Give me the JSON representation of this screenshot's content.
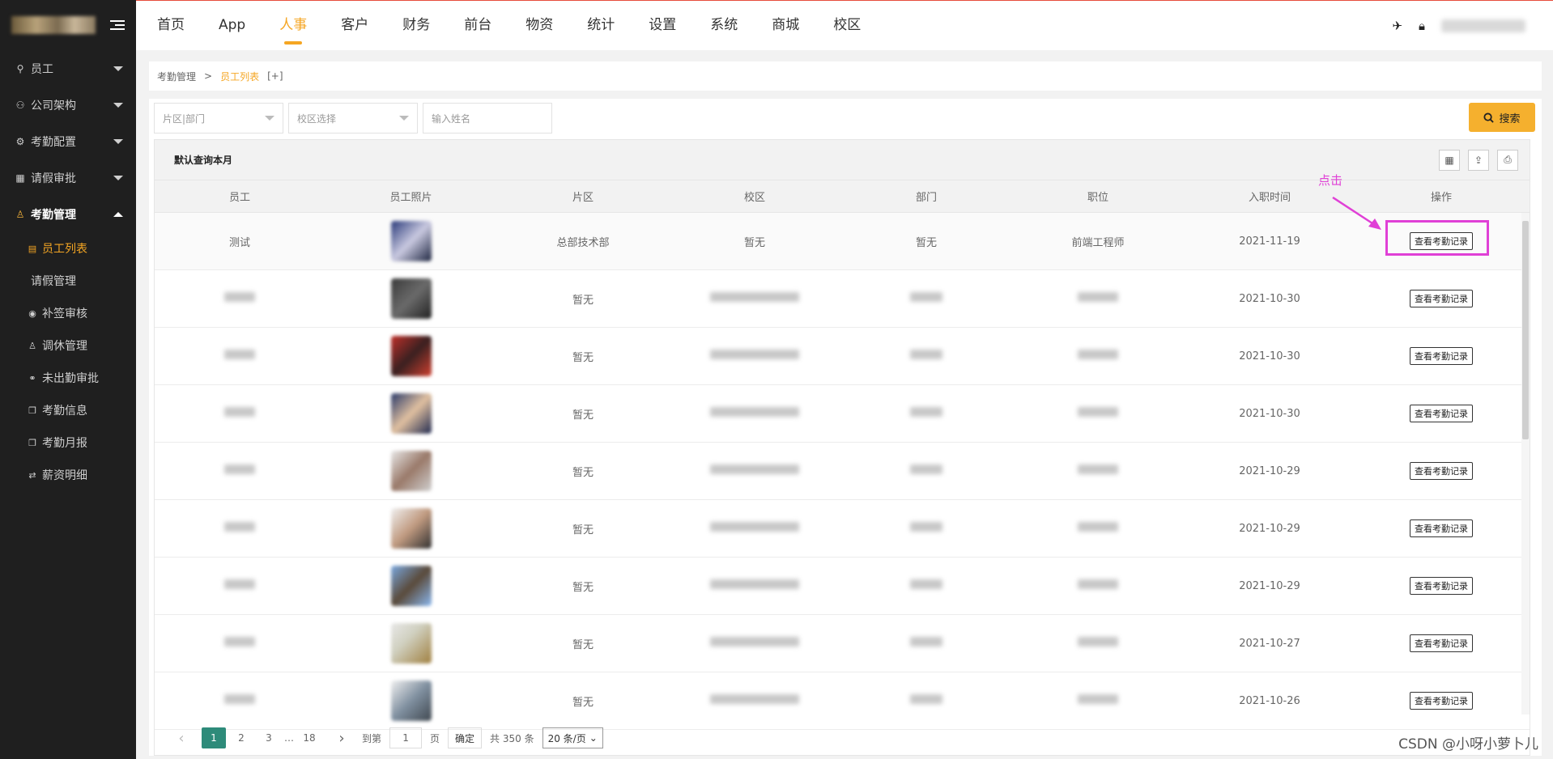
{
  "colors": {
    "accent": "#f5a623",
    "sidebar_bg": "#1f1f1f",
    "annotation": "#e040d6",
    "pager_active": "#2e8b7a"
  },
  "sidebar": {
    "menu": [
      {
        "label": "员工",
        "icon": "user-icon"
      },
      {
        "label": "公司架构",
        "icon": "org-icon"
      },
      {
        "label": "考勤配置",
        "icon": "settings-icon"
      },
      {
        "label": "请假审批",
        "icon": "grid-icon"
      },
      {
        "label": "考勤管理",
        "icon": "user-group-icon"
      }
    ],
    "submenu": [
      {
        "label": "员工列表",
        "icon": "list-icon"
      },
      {
        "label": "请假管理",
        "icon": ""
      },
      {
        "label": "补签审核",
        "icon": "compass-icon"
      },
      {
        "label": "调休管理",
        "icon": "person-icon"
      },
      {
        "label": "未出勤审批",
        "icon": "link-icon"
      },
      {
        "label": "考勤信息",
        "icon": "copy-icon"
      },
      {
        "label": "考勤月报",
        "icon": "copy-icon"
      },
      {
        "label": "薪资明细",
        "icon": "swap-icon"
      }
    ]
  },
  "topnav": [
    "首页",
    "App",
    "人事",
    "客户",
    "财务",
    "前台",
    "物资",
    "统计",
    "设置",
    "系统",
    "商城",
    "校区"
  ],
  "breadcrumb": {
    "parent": "考勤管理",
    "sep": ">",
    "current": "员工列表",
    "extra": "[+]"
  },
  "filters": {
    "area": "片区|部门",
    "campus": "校区选择",
    "name_placeholder": "输入姓名",
    "search": "搜索"
  },
  "table": {
    "title": "默认查询本月",
    "headers": [
      "员工",
      "员工照片",
      "片区",
      "校区",
      "部门",
      "职位",
      "入职时间",
      "操作"
    ],
    "action_label": "查看考勤记录",
    "rows": [
      {
        "name": "测试",
        "area": "总部技术部",
        "campus": "暂无",
        "dept": "暂无",
        "position": "前端工程师",
        "date": "2021-11-19"
      },
      {
        "name": "",
        "area": "暂无",
        "campus": "",
        "dept": "",
        "position": "",
        "date": "2021-10-30"
      },
      {
        "name": "",
        "area": "暂无",
        "campus": "",
        "dept": "",
        "position": "",
        "date": "2021-10-30"
      },
      {
        "name": "",
        "area": "暂无",
        "campus": "",
        "dept": "",
        "position": "",
        "date": "2021-10-30"
      },
      {
        "name": "",
        "area": "暂无",
        "campus": "",
        "dept": "",
        "position": "",
        "date": "2021-10-29"
      },
      {
        "name": "",
        "area": "暂无",
        "campus": "",
        "dept": "",
        "position": "",
        "date": "2021-10-29"
      },
      {
        "name": "",
        "area": "暂无",
        "campus": "",
        "dept": "",
        "position": "",
        "date": "2021-10-29"
      },
      {
        "name": "",
        "area": "暂无",
        "campus": "",
        "dept": "",
        "position": "",
        "date": "2021-10-27"
      },
      {
        "name": "",
        "area": "暂无",
        "campus": "",
        "dept": "",
        "position": "",
        "date": "2021-10-26"
      }
    ]
  },
  "annotation": "点击",
  "pager": {
    "prev": "‹",
    "pages": [
      "1",
      "2",
      "3",
      "…",
      "18"
    ],
    "next": "›",
    "goto": "到第",
    "page_value": "1",
    "page_unit": "页",
    "confirm": "确定",
    "total": "共 350 条",
    "per_page": "20 条/页"
  },
  "watermark": "CSDN @小呀小萝卜儿"
}
